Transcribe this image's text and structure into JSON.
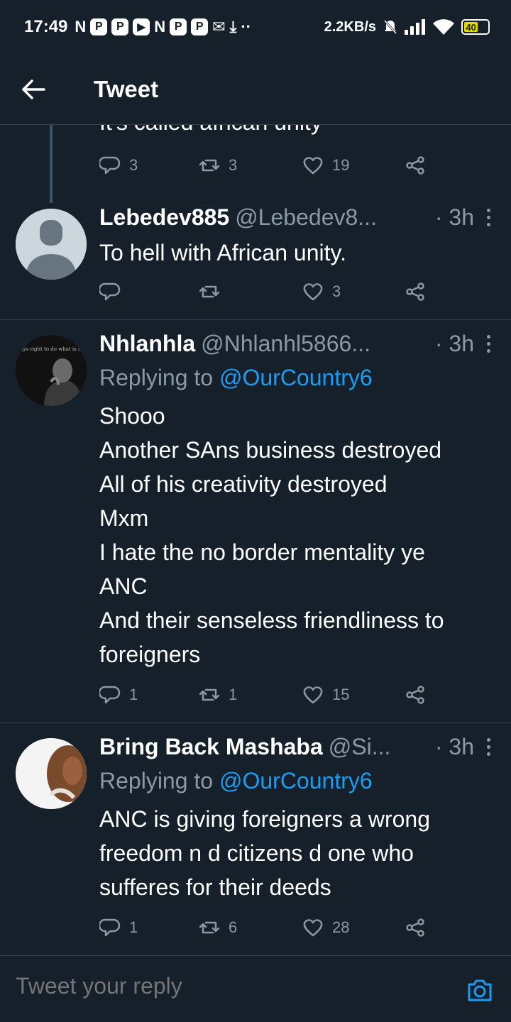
{
  "status_bar": {
    "time": "17:49",
    "notification_icons": [
      "N",
      "P",
      "P",
      "▶",
      "N",
      "P",
      "P"
    ],
    "net_speed": "2.2KB/s",
    "battery": "40"
  },
  "header": {
    "title": "Tweet"
  },
  "partial_tweet": {
    "text": "It's called african unity",
    "reply_count": "3",
    "retweet_count": "3",
    "like_count": "19"
  },
  "tweets": [
    {
      "name": "Lebedev885",
      "handle": "@Lebedev8...",
      "time": "· 3h",
      "replying_label": "",
      "replying_to": "",
      "lines": [
        "To hell with African unity."
      ],
      "reply_count": "",
      "retweet_count": "",
      "like_count": "3"
    },
    {
      "name": "Nhlanhla",
      "handle": "@Nhlanhl5866...",
      "time": "· 3h",
      "replying_label": "Replying to ",
      "replying_to": "@OurCountry6",
      "avatar_quote": "The time is always right to do what is right.",
      "lines": [
        "Shooo",
        "Another SAns business destroyed",
        "All of his creativity destroyed",
        "Mxm",
        "I hate the no border mentality ye",
        "ANC",
        "And their senseless friendliness to",
        "foreigners"
      ],
      "reply_count": "1",
      "retweet_count": "1",
      "like_count": "15"
    },
    {
      "name": "Bring Back Mashaba",
      "handle": "@Si...",
      "time": "· 3h",
      "replying_label": "Replying to ",
      "replying_to": "@OurCountry6",
      "lines": [
        "ANC is giving foreigners a wrong",
        "freedom n d citizens d one who",
        "sufferes for their deeds"
      ],
      "reply_count": "1",
      "retweet_count": "6",
      "like_count": "28"
    }
  ],
  "reply_bar": {
    "placeholder": "Tweet your reply"
  },
  "colors": {
    "background": "#15202b",
    "muted": "#8b98a5",
    "accent": "#1d9bf0",
    "divider": "#38444d"
  }
}
